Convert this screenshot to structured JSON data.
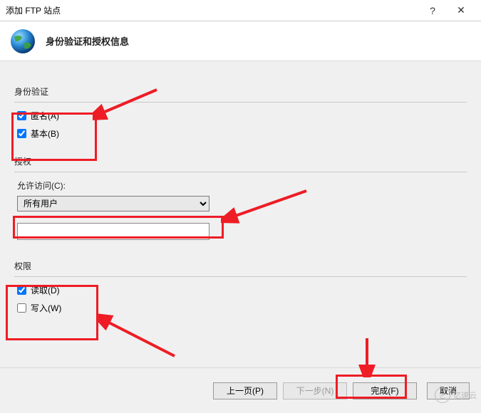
{
  "titlebar": {
    "title": "添加 FTP 站点",
    "help_symbol": "?",
    "close_symbol": "✕"
  },
  "header": {
    "heading": "身份验证和授权信息"
  },
  "auth": {
    "section_label": "身份验证",
    "anonymous": {
      "label": "匿名(A)",
      "checked": true
    },
    "basic": {
      "label": "基本(B)",
      "checked": true
    }
  },
  "authorization": {
    "section_label": "授权",
    "allow_access_label": "允许访问(C):",
    "selected_option": "所有用户"
  },
  "permissions": {
    "section_label": "权限",
    "read": {
      "label": "读取(D)",
      "checked": true
    },
    "write": {
      "label": "写入(W)",
      "checked": false
    }
  },
  "footer": {
    "previous": "上一页(P)",
    "next": "下一步(N)",
    "finish": "完成(F)",
    "cancel": "取消"
  },
  "watermark": {
    "text": "亿速云",
    "icon": "ㄜ"
  }
}
